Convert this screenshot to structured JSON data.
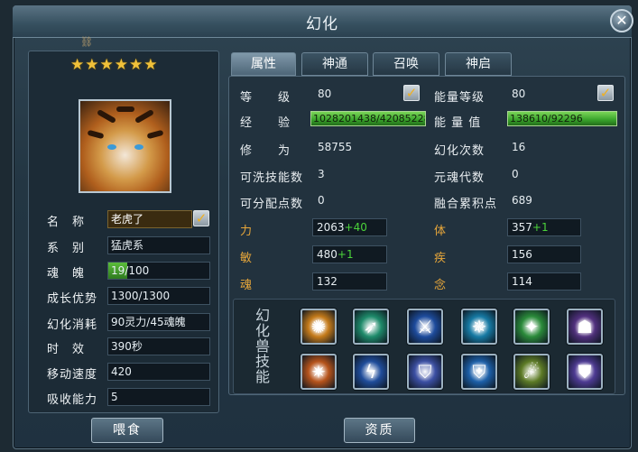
{
  "window": {
    "title": "幻化",
    "close_symbol": "✕"
  },
  "pet": {
    "stars": "★★★★★★",
    "fields": [
      {
        "label": "名　称",
        "value": "老虎了"
      },
      {
        "label": "系　别",
        "value": "猛虎系"
      },
      {
        "label": "魂　魄",
        "value": "19/100",
        "progress": 0.19
      },
      {
        "label": "成长优势",
        "value": "1300/1300"
      },
      {
        "label": "幻化消耗",
        "value": "90灵力/45魂魄"
      },
      {
        "label": "时　效",
        "value": "390秒"
      },
      {
        "label": "移动速度",
        "value": "420"
      },
      {
        "label": "吸收能力",
        "value": "5"
      }
    ],
    "soul_value": "19",
    "soul_max": "/100"
  },
  "tabs": [
    "属性",
    "神通",
    "召唤",
    "神启"
  ],
  "stats_left": [
    {
      "label": "等　　级",
      "value": "80"
    },
    {
      "label": "经　　验",
      "value": "1028201438/420852288",
      "progress": 1.0
    },
    {
      "label": "修　　为",
      "value": "58755"
    },
    {
      "label": "可洗技能数",
      "value": "3"
    },
    {
      "label": "可分配点数",
      "value": "0"
    }
  ],
  "stats_right": [
    {
      "label": "能量等级",
      "value": "80"
    },
    {
      "label": "能 量 值",
      "value": "138610/92296",
      "progress": 1.0
    },
    {
      "label": "幻化次数",
      "value": "16"
    },
    {
      "label": "元魂代数",
      "value": "0"
    },
    {
      "label": "融合累积点",
      "value": "689"
    }
  ],
  "attrs_left": [
    {
      "label": "力",
      "base": "2063",
      "bonus": "+40"
    },
    {
      "label": "敏",
      "base": "480",
      "bonus": "+1"
    },
    {
      "label": "魂",
      "base": "132",
      "bonus": ""
    }
  ],
  "attrs_right": [
    {
      "label": "体",
      "base": "357",
      "bonus": "+1"
    },
    {
      "label": "疾",
      "base": "156",
      "bonus": ""
    },
    {
      "label": "念",
      "base": "114",
      "bonus": ""
    }
  ],
  "skills_title": "幻化兽技能",
  "skills": [
    {
      "icon": "sunburst-icon",
      "glyph": "✺",
      "color": "#c47a1a"
    },
    {
      "icon": "green-slash-icon",
      "glyph": "➶",
      "color": "#1e8a6a"
    },
    {
      "icon": "blue-blade-icon",
      "glyph": "⚔",
      "color": "#1d4b9c"
    },
    {
      "icon": "cyan-vortex-icon",
      "glyph": "✵",
      "color": "#1679a3"
    },
    {
      "icon": "green-claw-icon",
      "glyph": "✦",
      "color": "#2a8a3a"
    },
    {
      "icon": "purple-figure-icon",
      "glyph": "☗",
      "color": "#51307e"
    },
    {
      "icon": "flame-claw-icon",
      "glyph": "✷",
      "color": "#b5531b"
    },
    {
      "icon": "lightning-strike-icon",
      "glyph": "ϟ",
      "color": "#1f4c9a"
    },
    {
      "icon": "violet-shield-icon",
      "glyph": "⛉",
      "color": "#3b4fa3"
    },
    {
      "icon": "blue-shield-icon",
      "glyph": "⛨",
      "color": "#1c5fa8"
    },
    {
      "icon": "light-beam-icon",
      "glyph": "☄",
      "color": "#5c7a25"
    },
    {
      "icon": "purple-shield-icon",
      "glyph": "⛊",
      "color": "#4d3a92"
    }
  ],
  "buttons": {
    "feed": "喂食",
    "aptitude": "资质"
  },
  "colors": {
    "accent_gold": "#e8a73a",
    "bonus_green": "#4bd23a",
    "bar_green": "#37a12a"
  }
}
